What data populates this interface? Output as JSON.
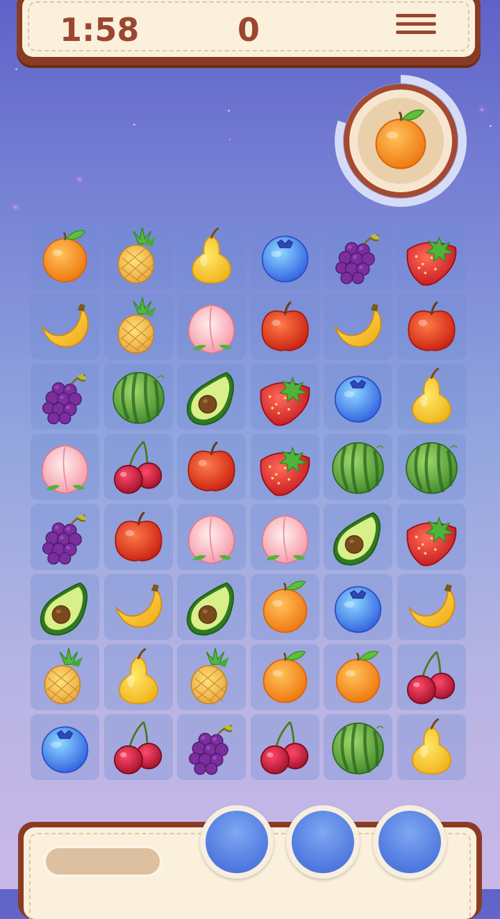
{
  "hud": {
    "timer": "1:58",
    "score": "0",
    "menu_icon": "hamburger-menu-icon"
  },
  "target": {
    "fruit": "orange",
    "progress_fraction": 0.8
  },
  "board": {
    "rows": 8,
    "cols": 6,
    "cells": [
      [
        "orange",
        "pineapple",
        "pear",
        "blueberry",
        "grapes",
        "strawberry"
      ],
      [
        "banana",
        "pineapple",
        "peach",
        "apple",
        "banana",
        "apple"
      ],
      [
        "grapes",
        "watermelon",
        "avocado",
        "strawberry",
        "blueberry",
        "pear"
      ],
      [
        "peach",
        "cherry",
        "apple",
        "strawberry",
        "watermelon",
        "watermelon"
      ],
      [
        "grapes",
        "apple",
        "peach",
        "peach",
        "avocado",
        "strawberry"
      ],
      [
        "avocado",
        "banana",
        "avocado",
        "orange",
        "blueberry",
        "banana"
      ],
      [
        "pineapple",
        "pear",
        "pineapple",
        "orange",
        "orange",
        "cherry"
      ],
      [
        "blueberry",
        "cherry",
        "grapes",
        "cherry",
        "watermelon",
        "pear"
      ]
    ]
  },
  "collector": {
    "progress_fraction": 0,
    "slots": [
      "empty",
      "empty",
      "empty"
    ]
  },
  "colors": {
    "frame": "#8a3b24",
    "panel": "#fbf0dc",
    "text": "#9b4630",
    "slot": "#4f79df"
  }
}
